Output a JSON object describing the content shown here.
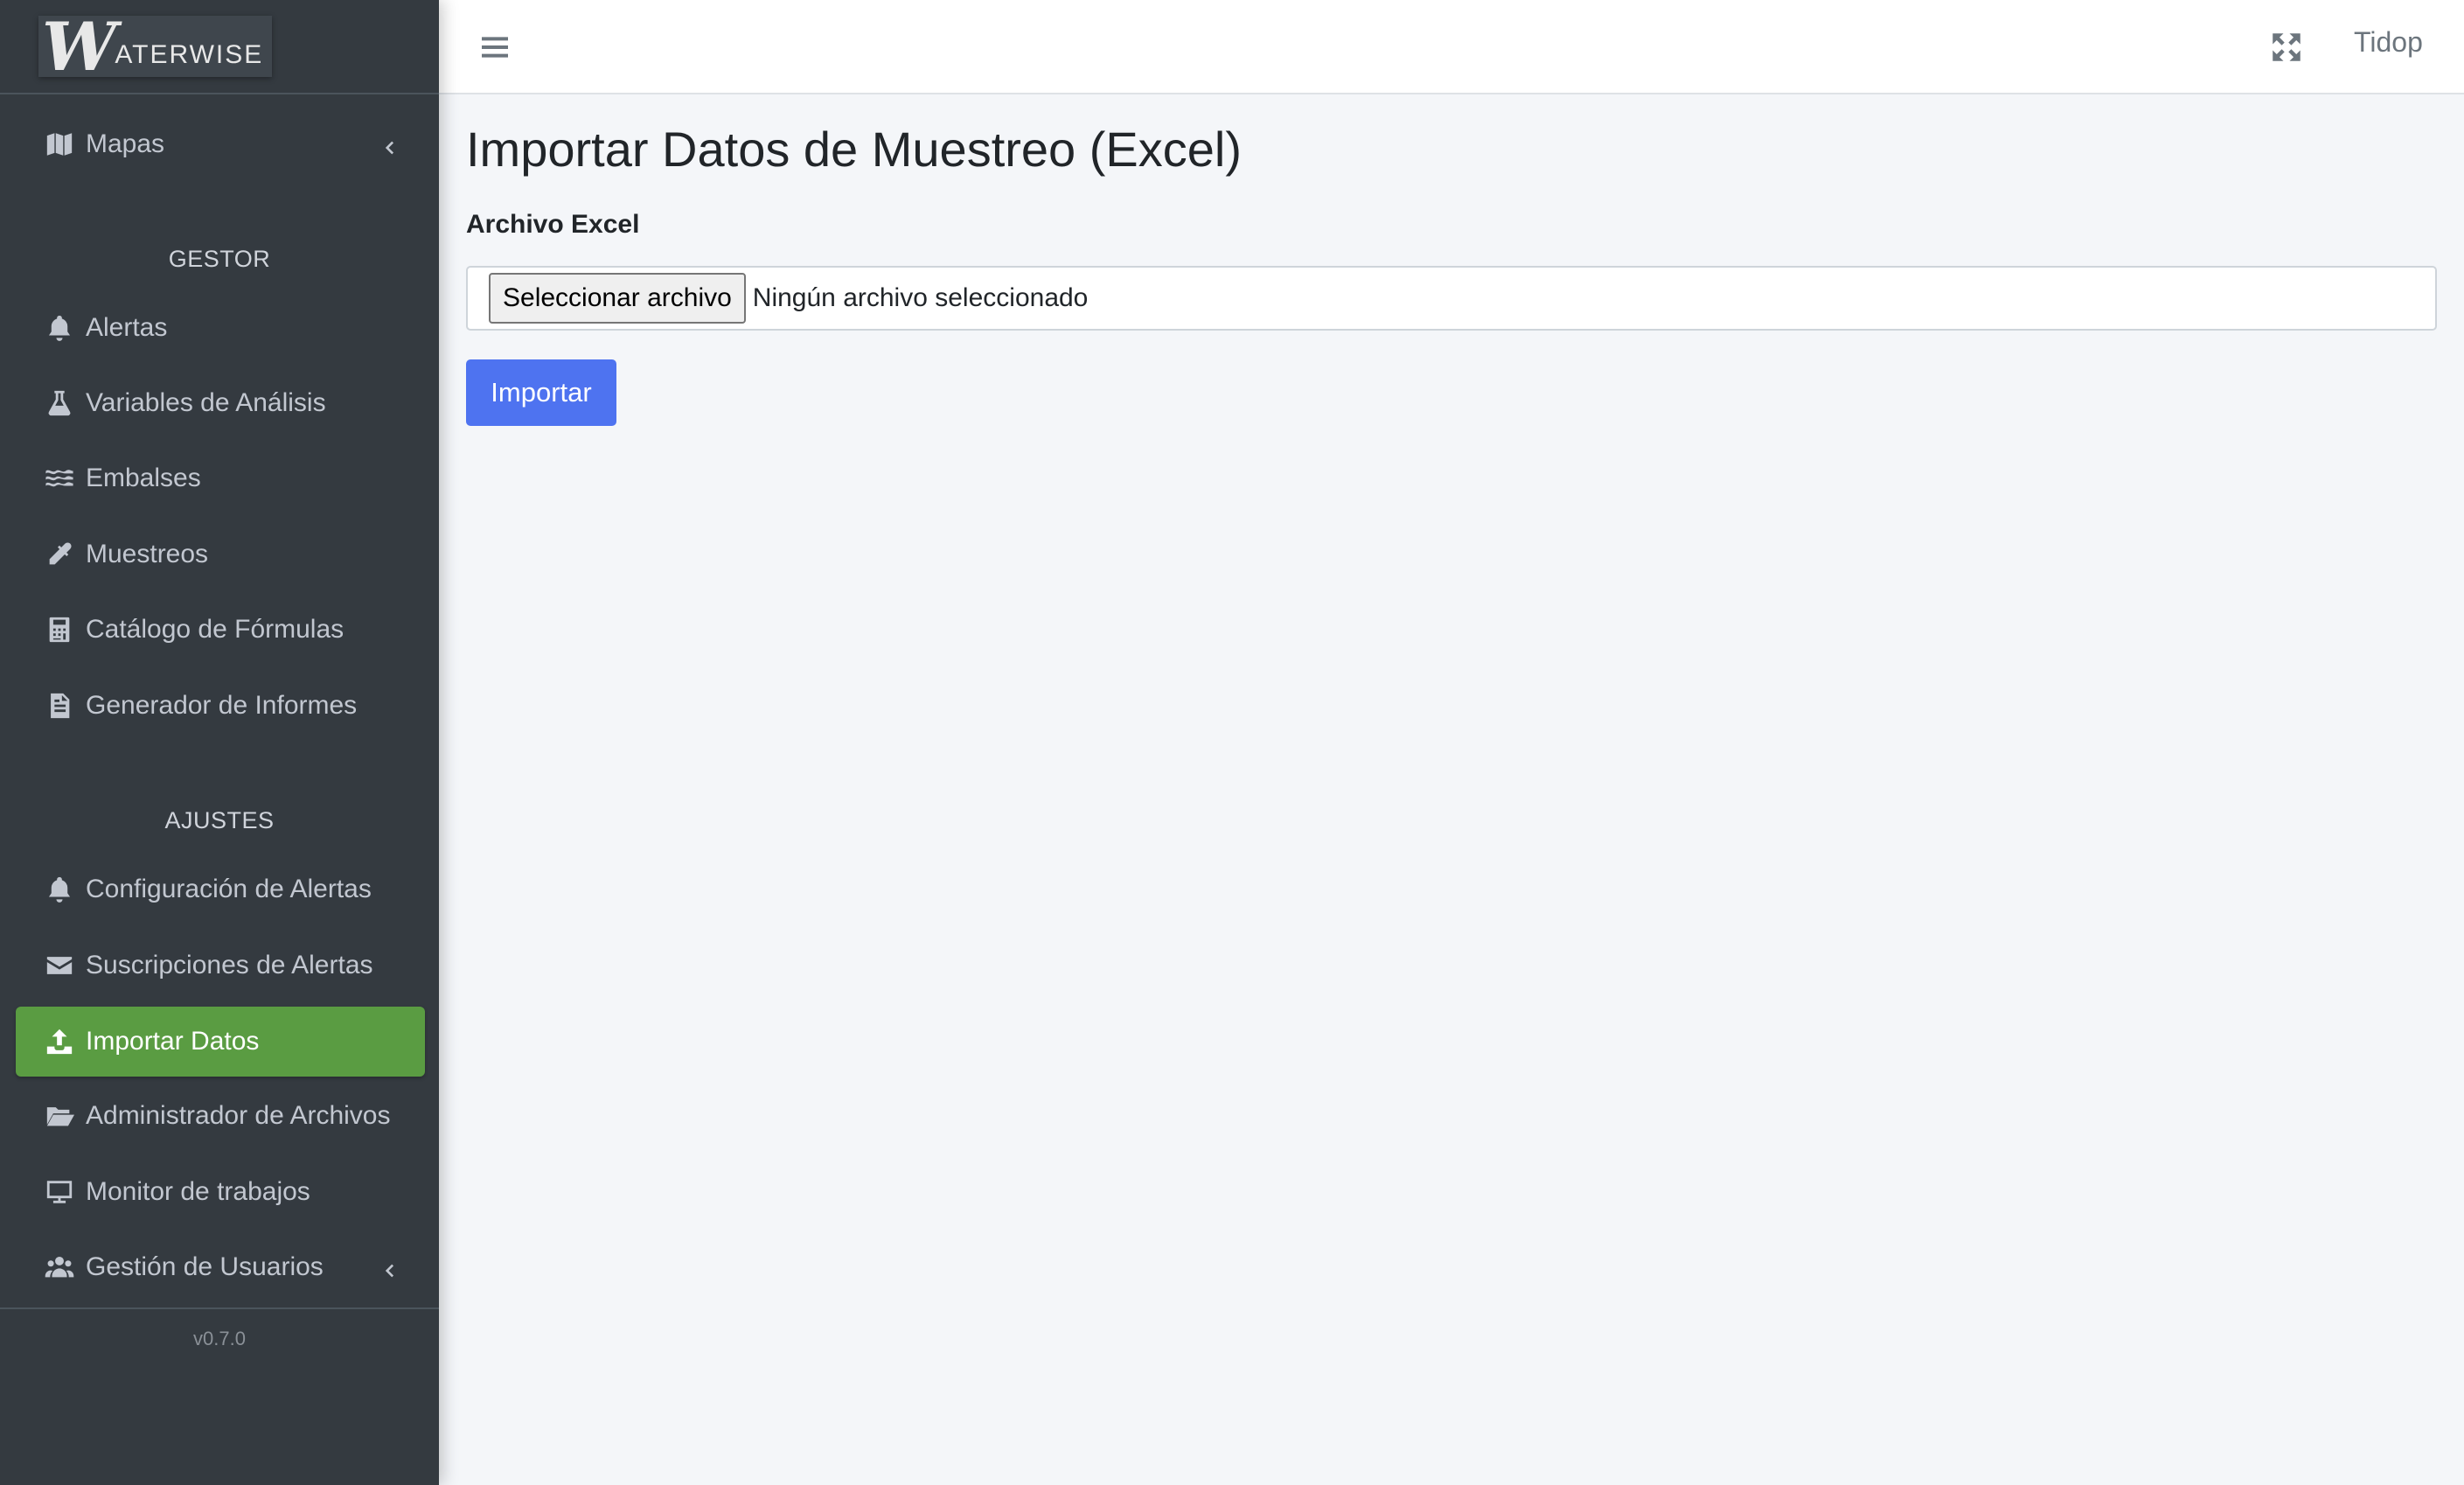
{
  "brand": {
    "logo_initial": "W",
    "logo_text": "ATERWISE"
  },
  "sidebar": {
    "top_items": [
      {
        "label": "Mapas",
        "icon": "map-icon",
        "has_chevron": true
      }
    ],
    "sections": [
      {
        "header": "GESTOR",
        "items": [
          {
            "label": "Alertas",
            "icon": "bell-icon"
          },
          {
            "label": "Variables de Análisis",
            "icon": "flask-icon"
          },
          {
            "label": "Embalses",
            "icon": "water-icon"
          },
          {
            "label": "Muestreos",
            "icon": "eyedropper-icon"
          },
          {
            "label": "Catálogo de Fórmulas",
            "icon": "calculator-icon"
          },
          {
            "label": "Generador de Informes",
            "icon": "file-icon"
          }
        ]
      },
      {
        "header": "AJUSTES",
        "items": [
          {
            "label": "Configuración de Alertas",
            "icon": "bell-icon"
          },
          {
            "label": "Suscripciones de Alertas",
            "icon": "envelope-icon"
          },
          {
            "label": "Importar Datos",
            "icon": "upload-icon",
            "active": true
          },
          {
            "label": "Administrador de Archivos",
            "icon": "folder-open-icon"
          },
          {
            "label": "Monitor de trabajos",
            "icon": "desktop-icon"
          },
          {
            "label": "Gestión de Usuarios",
            "icon": "users-icon",
            "has_chevron": true
          }
        ]
      }
    ],
    "version": "v0.7.0"
  },
  "topbar": {
    "menu_icon": "hamburger-icon",
    "fullscreen_icon": "expand-icon",
    "user": "Tidop"
  },
  "main": {
    "title": "Importar Datos de Muestreo (Excel)",
    "file_label": "Archivo Excel",
    "file_button": "Seleccionar archivo",
    "file_status": "Ningún archivo seleccionado",
    "submit_label": "Importar"
  },
  "colors": {
    "sidebar_bg": "#343a40",
    "active_item": "#5a9c42",
    "primary_button": "#4e73f0",
    "content_bg": "#f4f6f9"
  }
}
